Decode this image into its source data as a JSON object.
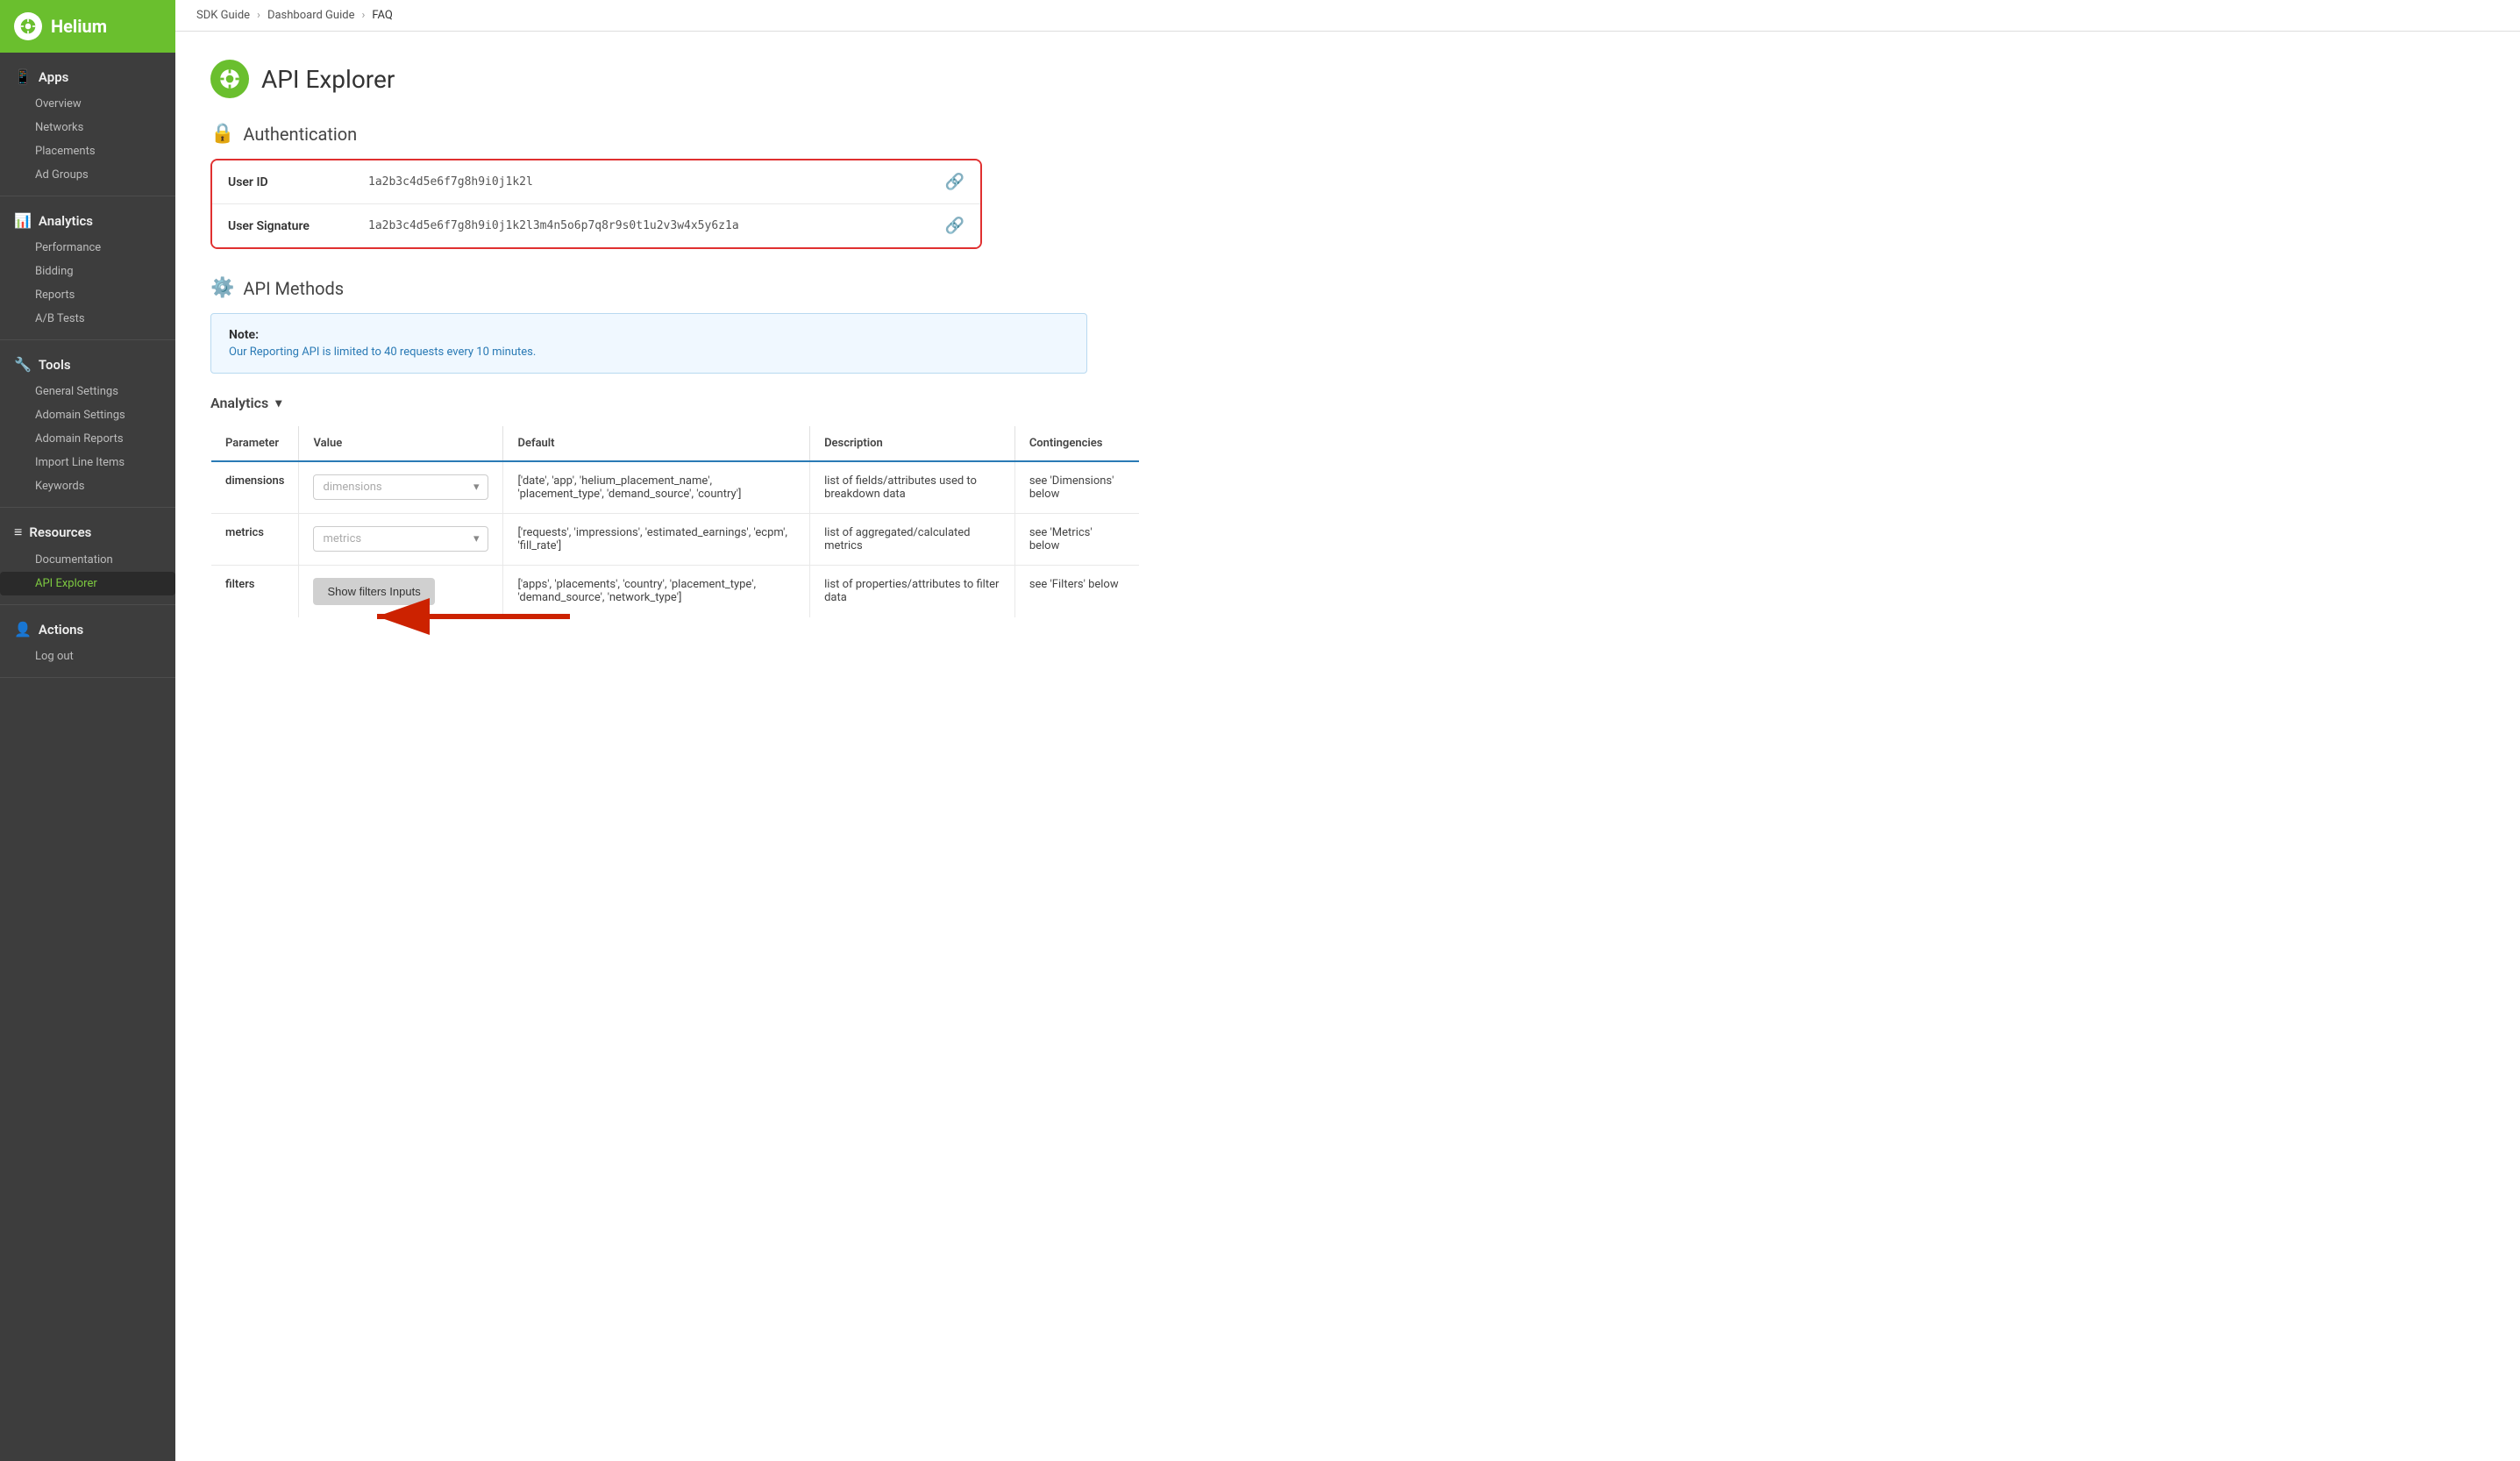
{
  "sidebar": {
    "app_name": "Helium",
    "sections": [
      {
        "id": "apps",
        "label": "Apps",
        "icon": "📱",
        "items": [
          {
            "id": "overview",
            "label": "Overview"
          },
          {
            "id": "networks",
            "label": "Networks"
          },
          {
            "id": "placements",
            "label": "Placements"
          },
          {
            "id": "ad-groups",
            "label": "Ad Groups"
          }
        ]
      },
      {
        "id": "analytics",
        "label": "Analytics",
        "icon": "📊",
        "items": [
          {
            "id": "performance",
            "label": "Performance"
          },
          {
            "id": "bidding",
            "label": "Bidding"
          },
          {
            "id": "reports",
            "label": "Reports"
          },
          {
            "id": "ab-tests",
            "label": "A/B Tests"
          }
        ]
      },
      {
        "id": "tools",
        "label": "Tools",
        "icon": "🔧",
        "items": [
          {
            "id": "general-settings",
            "label": "General Settings"
          },
          {
            "id": "adomain-settings",
            "label": "Adomain Settings"
          },
          {
            "id": "adomain-reports",
            "label": "Adomain Reports"
          },
          {
            "id": "import-line-items",
            "label": "Import Line Items"
          },
          {
            "id": "keywords",
            "label": "Keywords"
          }
        ]
      },
      {
        "id": "resources",
        "label": "Resources",
        "icon": "≡",
        "items": [
          {
            "id": "documentation",
            "label": "Documentation"
          },
          {
            "id": "api-explorer",
            "label": "API Explorer",
            "active": true
          }
        ]
      },
      {
        "id": "actions",
        "label": "Actions",
        "icon": "👤",
        "items": [
          {
            "id": "log-out",
            "label": "Log out"
          }
        ]
      }
    ]
  },
  "breadcrumb": {
    "items": [
      "SDK Guide",
      "Dashboard Guide",
      "FAQ"
    ]
  },
  "page": {
    "title": "API Explorer",
    "auth": {
      "section_title": "Authentication",
      "rows": [
        {
          "label": "User ID",
          "value": "1a2b3c4d5e6f7g8h9i0j1k2l"
        },
        {
          "label": "User Signature",
          "value": "1a2b3c4d5e6f7g8h9i0j1k2l3m4n5o6p7q8r9s0t1u2v3w4x5y6z1a"
        }
      ]
    },
    "api_methods": {
      "section_title": "API Methods",
      "note": {
        "title": "Note:",
        "body": "Our Reporting API is limited to 40 requests every 10 minutes."
      },
      "analytics_label": "Analytics",
      "table": {
        "headers": [
          "Parameter",
          "Value",
          "Default",
          "Description",
          "Contingencies"
        ],
        "rows": [
          {
            "parameter": "dimensions",
            "value_placeholder": "dimensions",
            "default": "['date', 'app', 'helium_placement_name', 'placement_type', 'demand_source', 'country']",
            "description": "list of fields/attributes used to breakdown data",
            "contingencies": "see 'Dimensions' below"
          },
          {
            "parameter": "metrics",
            "value_placeholder": "metrics",
            "default": "['requests', 'impressions', 'estimated_earnings', 'ecpm', 'fill_rate']",
            "description": "list of aggregated/calculated metrics",
            "contingencies": "see 'Metrics' below"
          },
          {
            "parameter": "filters",
            "value_button": "Show filters Inputs",
            "default": "['apps', 'placements', 'country', 'placement_type', 'demand_source', 'network_type']",
            "description": "list of properties/attributes to filter data",
            "contingencies": "see 'Filters' below"
          }
        ]
      }
    }
  }
}
